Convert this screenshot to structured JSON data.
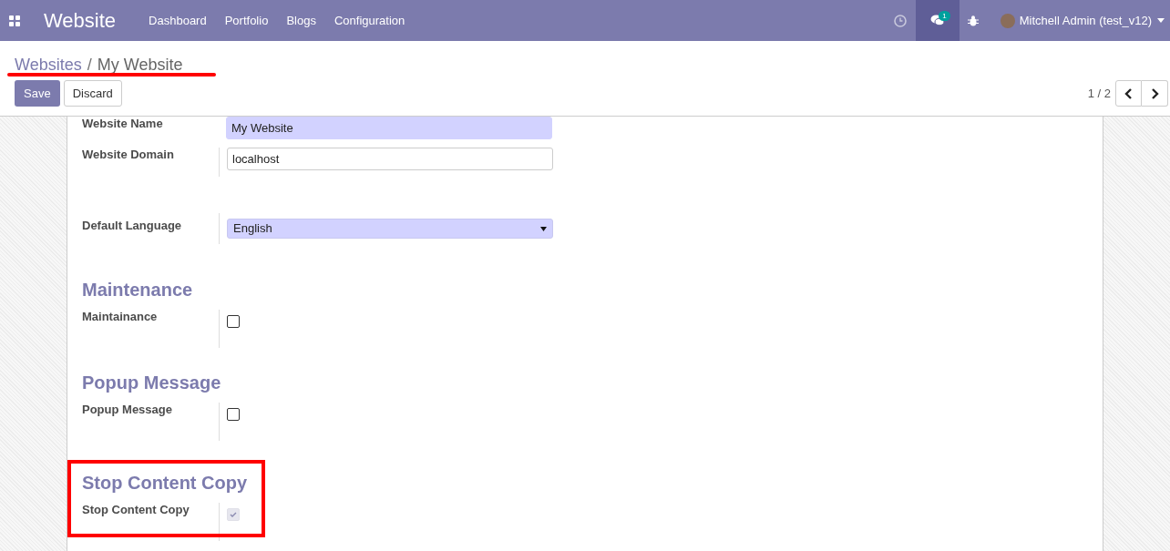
{
  "navbar": {
    "app_title": "Website",
    "menu": [
      "Dashboard",
      "Portfolio",
      "Blogs",
      "Configuration"
    ],
    "chat_badge": "1",
    "user": "Mitchell Admin (test_v12)"
  },
  "breadcrumb_separator": "/",
  "breadcrumb": [
    {
      "label": "Websites",
      "link": true
    },
    {
      "label": "My Website",
      "link": false
    }
  ],
  "buttons": [
    {
      "label": "Save",
      "kind": "primary"
    },
    {
      "label": "Discard",
      "kind": "secondary"
    }
  ],
  "pager": "1 / 2",
  "sections": [
    {
      "fields": [
        {
          "label": "Website Name",
          "kind": "text",
          "value": "My Website",
          "required": true
        },
        {
          "label": "Website Domain",
          "kind": "text",
          "value": "localhost",
          "required": false
        }
      ]
    },
    {
      "fields": [
        {
          "label": "Default Language",
          "kind": "select",
          "value": "English",
          "required": true
        }
      ]
    },
    {
      "heading": "Maintenance",
      "fields": [
        {
          "label": "Maintainance",
          "kind": "checkbox",
          "checked": false,
          "disabled": false
        }
      ]
    },
    {
      "heading": "Popup Message",
      "fields": [
        {
          "label": "Popup Message",
          "kind": "checkbox",
          "checked": false,
          "disabled": false
        }
      ]
    },
    {
      "heading": "Stop Content Copy",
      "highlighted": true,
      "fields": [
        {
          "label": "Stop Content Copy",
          "kind": "checkbox",
          "checked": true,
          "disabled": true
        }
      ]
    }
  ]
}
